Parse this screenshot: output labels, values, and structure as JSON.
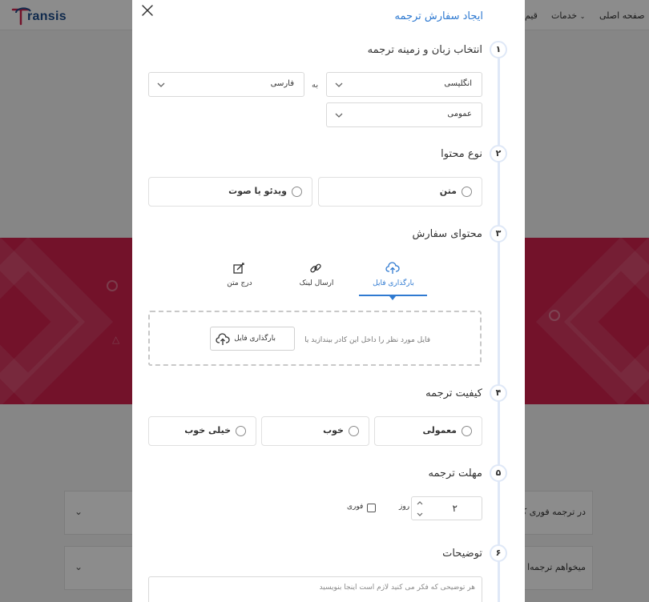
{
  "background": {
    "logo_text": "ransis",
    "nav": {
      "home": "صفحه اصلی",
      "services": "خدمات",
      "pricing_partial": "قیم"
    },
    "faq_items": [
      {
        "text": "در ترجمه فوری ک"
      },
      {
        "text": "میخواهم ترجمه‌ا"
      }
    ],
    "colors": {
      "hero": "#d2224e",
      "brand_blue": "#1e4d8c",
      "brand_red": "#d2224e"
    }
  },
  "modal": {
    "title": "ایجاد سفارش ترجمه",
    "accent_color": "#2f7ad1",
    "steps": [
      {
        "num": "۱",
        "title": "انتخاب زبان و زمینه ترجمه"
      },
      {
        "num": "۲",
        "title": "نوع محتوا"
      },
      {
        "num": "۳",
        "title": "محتوای سفارش"
      },
      {
        "num": "۴",
        "title": "کیفیت ترجمه"
      },
      {
        "num": "۵",
        "title": "مهلت ترجمه"
      },
      {
        "num": "۶",
        "title": "توضیحات"
      }
    ],
    "language": {
      "source": "انگلیسی",
      "to_label": "به",
      "target": "فارسی",
      "field": "عمومی"
    },
    "content_type": {
      "text": "متن",
      "video_audio": "ویدئو یا صوت"
    },
    "order_content": {
      "tabs": [
        {
          "label": "بارگذاری فایل",
          "icon": "cloud-upload-icon"
        },
        {
          "label": "ارسال لینک",
          "icon": "link-icon"
        },
        {
          "label": "درج متن",
          "icon": "edit-icon"
        }
      ],
      "dropzone_text": "فایل مورد نظر را داخل این کادر بیندازید یا",
      "upload_button": "بارگذاری فایل"
    },
    "quality": {
      "normal": "معمولی",
      "good": "خوب",
      "very_good": "خیلی خوب"
    },
    "deadline": {
      "days_value": "۲",
      "days_label": "روز",
      "urgent_label": "فوری"
    },
    "notes": {
      "placeholder": "هر توضیحی که فکر می کنید لازم است اینجا بنویسید"
    }
  }
}
